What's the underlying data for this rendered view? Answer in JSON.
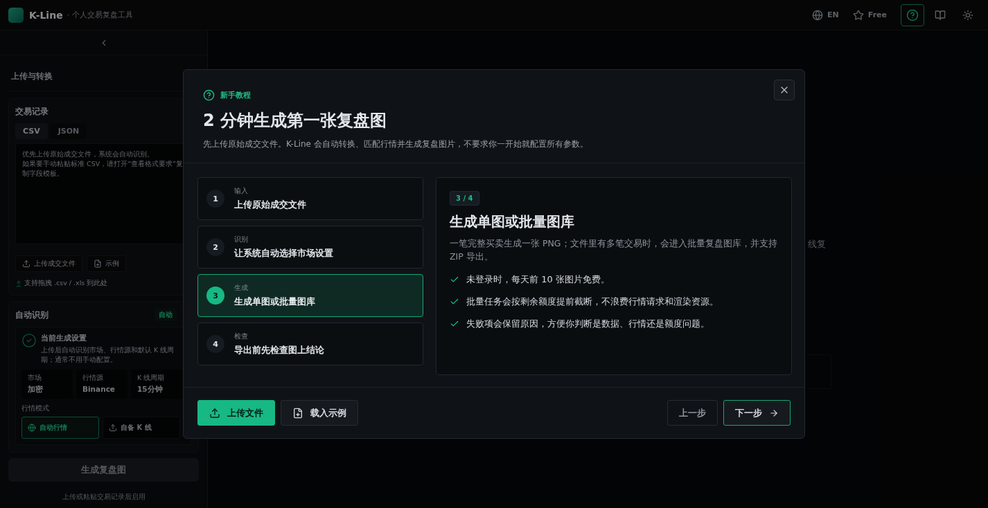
{
  "header": {
    "app_name": "K-Line",
    "tagline": "· 个人交易复盘工具",
    "language": "EN",
    "plan": "Free",
    "toolbar": [
      {
        "kind": "help",
        "selected": true
      },
      {
        "kind": "docs",
        "selected": false
      },
      {
        "kind": "theme",
        "selected": false
      }
    ]
  },
  "sidebar": {
    "section_title": "上传与转换",
    "trade_card": {
      "title": "交易记录",
      "tabs": [
        {
          "label": "CSV",
          "selected": true
        },
        {
          "label": "JSON",
          "selected": false
        }
      ],
      "placeholder": [
        "优先上传原始成交文件，系统会自动识别。",
        "如果要手动粘贴标准 CSV，请打开“查看格式要求”复制字段模板。"
      ],
      "buttons": [
        {
          "kind": "upload",
          "label": "上传成交文件"
        },
        {
          "kind": "sample",
          "label": "示例"
        }
      ],
      "hint": "支持拖拽 .csv / .xls 到此处"
    },
    "auto_card": {
      "title": "自动识别",
      "badge": "自动",
      "settings_title": "当前生成设置",
      "settings_desc": "上传后自动识别市场、行情源和默认 K 线周期；通常不用手动配置。",
      "tiles": [
        {
          "label": "市场",
          "value": "加密"
        },
        {
          "label": "行情源",
          "value": "Binance"
        },
        {
          "label": "K 线周期",
          "value": "15分钟"
        }
      ],
      "mode_label": "行情模式",
      "modes": [
        {
          "kind": "auto",
          "label": "自动行情",
          "selected": true
        },
        {
          "kind": "upload",
          "label": "自备 K 线",
          "selected": false
        }
      ]
    },
    "generate_button": {
      "label": "生成复盘图",
      "disabled": true
    },
    "generate_note": "上传或粘贴交易记录后启用"
  },
  "main": {
    "fragment": "线复"
  },
  "dialog": {
    "eyebrow": "新手教程",
    "title": "2 分钟生成第一张复盘图",
    "subtitle": "先上传原始成交文件。K-Line 会自动转换、匹配行情并生成复盘图片，不要求你一开始就配置所有参数。",
    "steps": [
      {
        "number": "1",
        "label": "输入",
        "title": "上传原始成交文件",
        "selected": false
      },
      {
        "number": "2",
        "label": "识别",
        "title": "让系统自动选择市场设置",
        "selected": false
      },
      {
        "number": "3",
        "label": "生成",
        "title": "生成单图或批量图库",
        "selected": true
      },
      {
        "number": "4",
        "label": "检查",
        "title": "导出前先检查图上结论",
        "selected": false
      }
    ],
    "detail": {
      "counter": "3 / 4",
      "title": "生成单图或批量图库",
      "description": "一笔完整买卖生成一张 PNG；文件里有多笔交易时，会进入批量复盘图库，并支持 ZIP 导出。",
      "bullets": [
        "未登录时，每天前 10 张图片免费。",
        "批量任务会按剩余额度提前截断，不浪费行情请求和渲染资源。",
        "失败项会保留原因，方便你判断是数据、行情还是额度问题。"
      ]
    },
    "footer": {
      "left_buttons": [
        {
          "kind": "primary",
          "label": "上传文件"
        },
        {
          "kind": "secondary",
          "label": "载入示例"
        }
      ],
      "back": "上一步",
      "next": "下一步"
    }
  }
}
